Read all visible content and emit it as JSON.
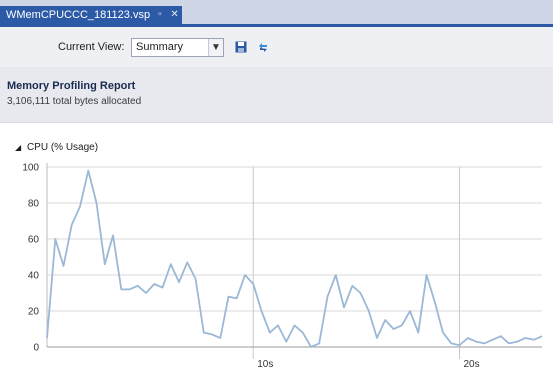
{
  "tab": {
    "title": "WMemCPUCCC_181123.vsp",
    "icons": "▫ ✕"
  },
  "toolbar": {
    "current_view_label": "Current View:",
    "current_view_value": "Summary",
    "save_icon": "save-icon",
    "refresh_icon": "refresh-icon"
  },
  "report": {
    "title": "Memory Profiling Report",
    "subtitle": "3,106,111 total bytes allocated"
  },
  "colors": {
    "accent": "#2d5aa6",
    "line": "#9bb8d6",
    "grid": "#d9d9d9"
  },
  "chart_data": {
    "type": "line",
    "title": "CPU (% Usage)",
    "ylim": [
      0,
      100
    ],
    "yticks": [
      "100",
      "80",
      "60",
      "40",
      "20",
      "0"
    ],
    "xticks": [
      "10s",
      "20s"
    ],
    "xtick_seconds": [
      10,
      20
    ],
    "xlim": [
      0,
      24
    ],
    "grid": true,
    "series": [
      {
        "x": [
          0,
          0.4,
          0.8,
          1.2,
          1.6,
          2.0,
          2.4,
          2.8,
          3.2,
          3.6,
          4.0,
          4.4,
          4.8,
          5.2,
          5.6,
          6.0,
          6.4,
          6.8,
          7.2,
          7.6,
          8.0,
          8.4,
          8.8,
          9.2,
          9.6,
          10.0,
          10.4,
          10.8,
          11.2,
          11.6,
          12.0,
          12.4,
          12.8,
          13.2,
          13.6,
          14.0,
          14.4,
          14.8,
          15.2,
          15.6,
          16.0,
          16.4,
          16.8,
          17.2,
          17.6,
          18.0,
          18.4,
          18.8,
          19.2,
          19.6,
          20.0,
          20.4,
          20.8,
          21.2,
          21.6,
          22.0,
          22.4,
          22.8,
          23.2,
          23.6,
          24.0
        ],
        "y": [
          5,
          60,
          45,
          68,
          78,
          98,
          80,
          46,
          62,
          32,
          32,
          34,
          30,
          35,
          33,
          46,
          36,
          47,
          38,
          8,
          7,
          5,
          28,
          27,
          40,
          35,
          20,
          8,
          12,
          3,
          12,
          8,
          0,
          2,
          28,
          40,
          22,
          34,
          30,
          20,
          5,
          15,
          10,
          12,
          20,
          8,
          40,
          25,
          8,
          2,
          1,
          5,
          3,
          2,
          4,
          6,
          2,
          3,
          5,
          4,
          6
        ]
      }
    ]
  }
}
